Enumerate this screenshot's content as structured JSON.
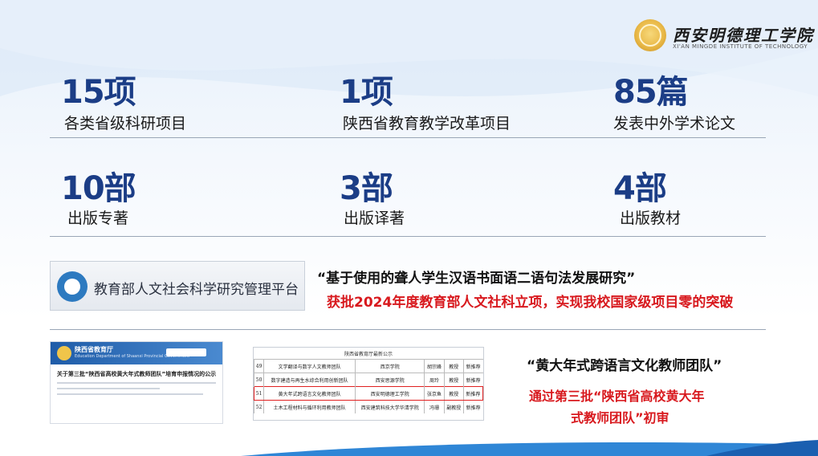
{
  "logo": {
    "name_cn": "西安明德理工学院",
    "name_en": "XI'AN MINGDE INSTITUTE OF TECHNOLOGY"
  },
  "stats": [
    {
      "num": "15项",
      "label": "各类省级科研项目"
    },
    {
      "num": "1项",
      "label": "陕西省教育教学改革项目"
    },
    {
      "num": "85篇",
      "label": "发表中外学术论文"
    },
    {
      "num": "10部",
      "label": "出版专著"
    },
    {
      "num": "3部",
      "label": "出版译著"
    },
    {
      "num": "4部",
      "label": "出版教材"
    }
  ],
  "platform": {
    "text": "教育部人文社会科学研究管理平台"
  },
  "project": {
    "title": "“基于使用的聋人学生汉语书面语二语句法发展研究”",
    "result": "获批2024年度教育部人文社科立项，实现我校国家级项目零的突破"
  },
  "doc": {
    "site_title": "陕西省教育厅",
    "site_sub": "Education Department of Shaanxi Provincial Government",
    "headline": "关于第三批“陕西省高校黄大年式教师团队”培育申报情况的公示"
  },
  "table": {
    "caption": "陕西省教育厅最新公示",
    "rows": [
      [
        "49",
        "文学翻译与数字人文教师团队",
        "西京学院",
        "胡宗峰",
        "教授",
        "新推荐"
      ],
      [
        "50",
        "数字建造与再生水综合利用创新团队",
        "西安思源学院",
        "周玲",
        "教授",
        "新推荐"
      ],
      [
        "51",
        "黄大年式跨语言文化教师团队",
        "西安明德理工学院",
        "张京鱼",
        "教授",
        "新推荐"
      ],
      [
        "52",
        "土木工程材料与循环利用教师团队",
        "西安建筑科技大学华清学院",
        "冯珊",
        "副教授",
        "新推荐"
      ]
    ],
    "highlight_row": 2
  },
  "team": {
    "title": "“黄大年式跨语言文化教师团队”",
    "result_line1": "通过第三批“陕西省高校黄大年",
    "result_line2": "式教师团队”初审"
  }
}
